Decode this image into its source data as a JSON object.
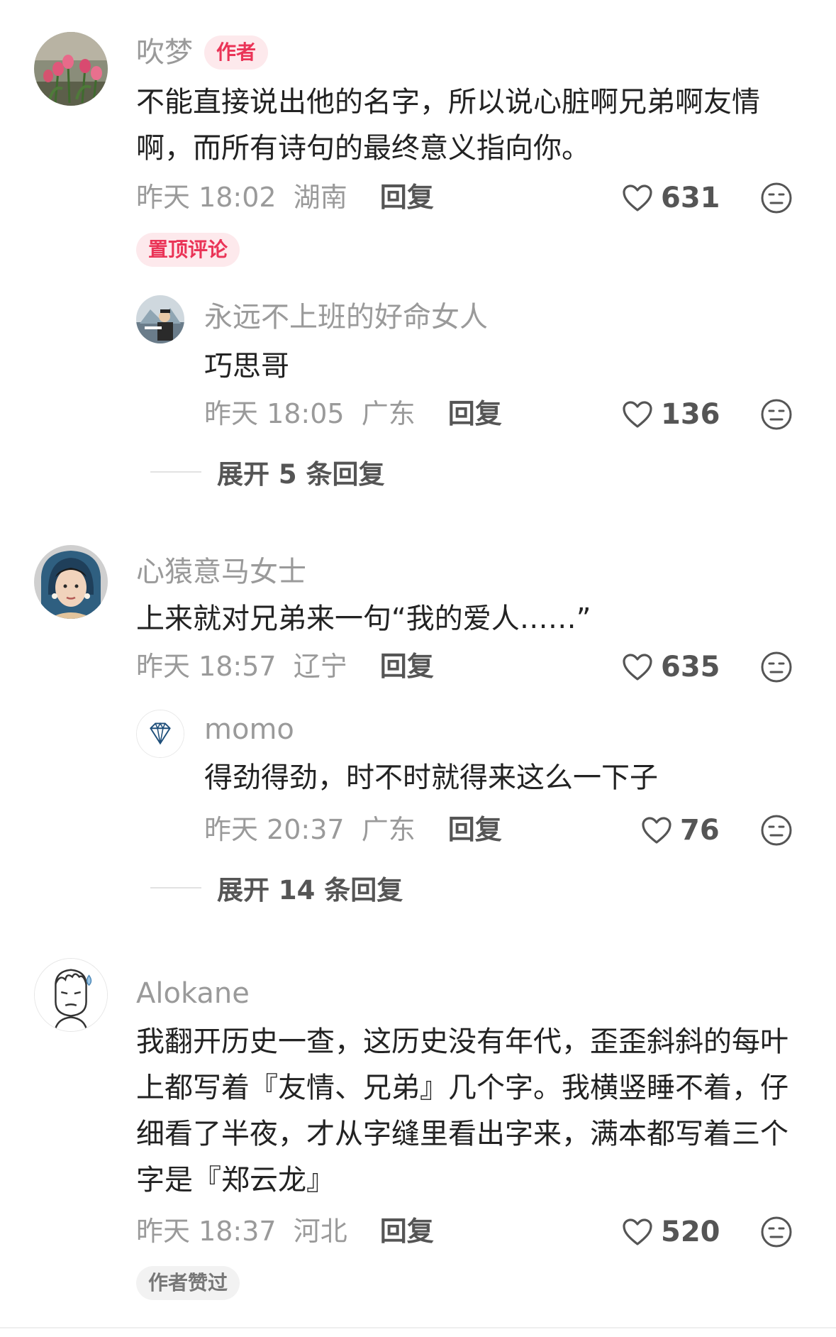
{
  "comments": [
    {
      "author": "吹梦",
      "badge": "作者",
      "text": "不能直接说出他的名字，所以说心脏啊兄弟啊友情啊，而所有诗句的最终意义指向你。",
      "time": "昨天 18:02",
      "location": "湖南",
      "reply_label": "回复",
      "likes": "631",
      "tag": "置顶评论",
      "replies": [
        {
          "author": "永远不上班的好命女人",
          "text": "巧思哥",
          "time": "昨天 18:05",
          "location": "广东",
          "reply_label": "回复",
          "likes": "136"
        }
      ],
      "expand_label": "展开 5 条回复"
    },
    {
      "author": "心猿意马女士",
      "text": "上来就对兄弟来一句“我的爱人……”",
      "time": "昨天 18:57",
      "location": "辽宁",
      "reply_label": "回复",
      "likes": "635",
      "replies": [
        {
          "author": "momo",
          "text": "得劲得劲，时不时就得来这么一下子",
          "time": "昨天 20:37",
          "location": "广东",
          "reply_label": "回复",
          "likes": "76"
        }
      ],
      "expand_label": "展开 14 条回复"
    },
    {
      "author": "Alokane",
      "text": "我翻开历史一查，这历史没有年代，歪歪斜斜的每叶上都写着『友情、兄弟』几个字。我横竖睡不着，仔细看了半夜，才从字缝里看出字来，满本都写着三个字是『郑云龙』",
      "time": "昨天 18:37",
      "location": "河北",
      "reply_label": "回复",
      "likes": "520",
      "tag": "作者赞过"
    }
  ],
  "icons": {
    "like": "heart-outline-icon",
    "dislike": "meh-face-icon",
    "momo_avatar": "diamond-icon"
  },
  "colors": {
    "accent": "#ea3457",
    "meta": "#9a9a9a",
    "text": "#222222"
  }
}
